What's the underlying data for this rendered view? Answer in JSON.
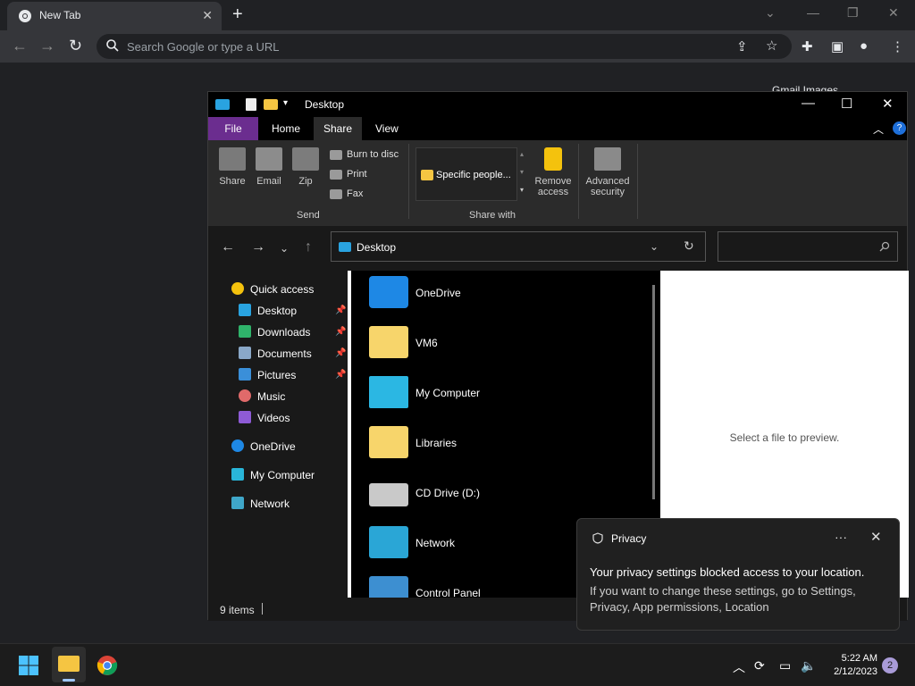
{
  "browser": {
    "tab_title": "New Tab",
    "omnibox_placeholder": "Search Google or type a URL",
    "ntp_links": "Gmail   Images"
  },
  "explorer": {
    "title": "Desktop",
    "tabs": [
      "File",
      "Home",
      "Share",
      "View"
    ],
    "ribbon": {
      "share": "Share",
      "email": "Email",
      "zip": "Zip",
      "burn": "Burn to disc",
      "print": "Print",
      "fax": "Fax",
      "send_group": "Send",
      "specific_people": "Specific people...",
      "remove_access": "Remove access",
      "advanced_security": "Advanced security",
      "share_with_group": "Share with"
    },
    "address": "Desktop",
    "nav": {
      "quick_access": "Quick access",
      "desktop": "Desktop",
      "downloads": "Downloads",
      "documents": "Documents",
      "pictures": "Pictures",
      "music": "Music",
      "videos": "Videos",
      "onedrive": "OneDrive",
      "my_computer": "My Computer",
      "network": "Network"
    },
    "files": [
      {
        "name": "OneDrive"
      },
      {
        "name": "VM6"
      },
      {
        "name": "My Computer"
      },
      {
        "name": "Libraries"
      },
      {
        "name": "CD Drive (D:)"
      },
      {
        "name": "Network"
      },
      {
        "name": "Control Panel"
      }
    ],
    "preview_text": "Select a file to preview.",
    "status": "9 items"
  },
  "toast": {
    "header": "Privacy",
    "line1": "Your privacy settings blocked access to your location.",
    "line2": "If you want to change these settings, go to Settings, Privacy, App permissions, Location"
  },
  "taskbar": {
    "time": "5:22 AM",
    "date": "2/12/2023",
    "notifications": "2"
  }
}
